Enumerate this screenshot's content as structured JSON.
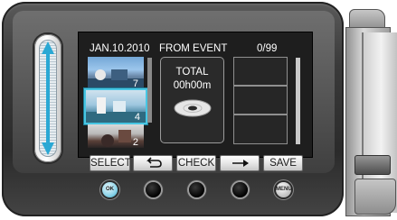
{
  "screen": {
    "date": "JAN.10.2010",
    "title": "FROM EVENT",
    "count": "0/99"
  },
  "thumbnails": [
    {
      "number": "7"
    },
    {
      "number": "4"
    },
    {
      "number": "2"
    }
  ],
  "total": {
    "label": "TOTAL",
    "time": "00h00m"
  },
  "softkeys": {
    "select": "SELECT",
    "check": "CHECK",
    "save": "SAVE"
  },
  "buttons": {
    "ok_label": "OK",
    "menu_label": "MENU"
  },
  "icons": {
    "slider": "up-down-arrow-icon",
    "back": "return-arrow-icon",
    "next": "right-arrow-icon",
    "total": "disc-icon"
  },
  "colors": {
    "accent": "#47c6e3",
    "ok_button": "#8cd3e8"
  }
}
